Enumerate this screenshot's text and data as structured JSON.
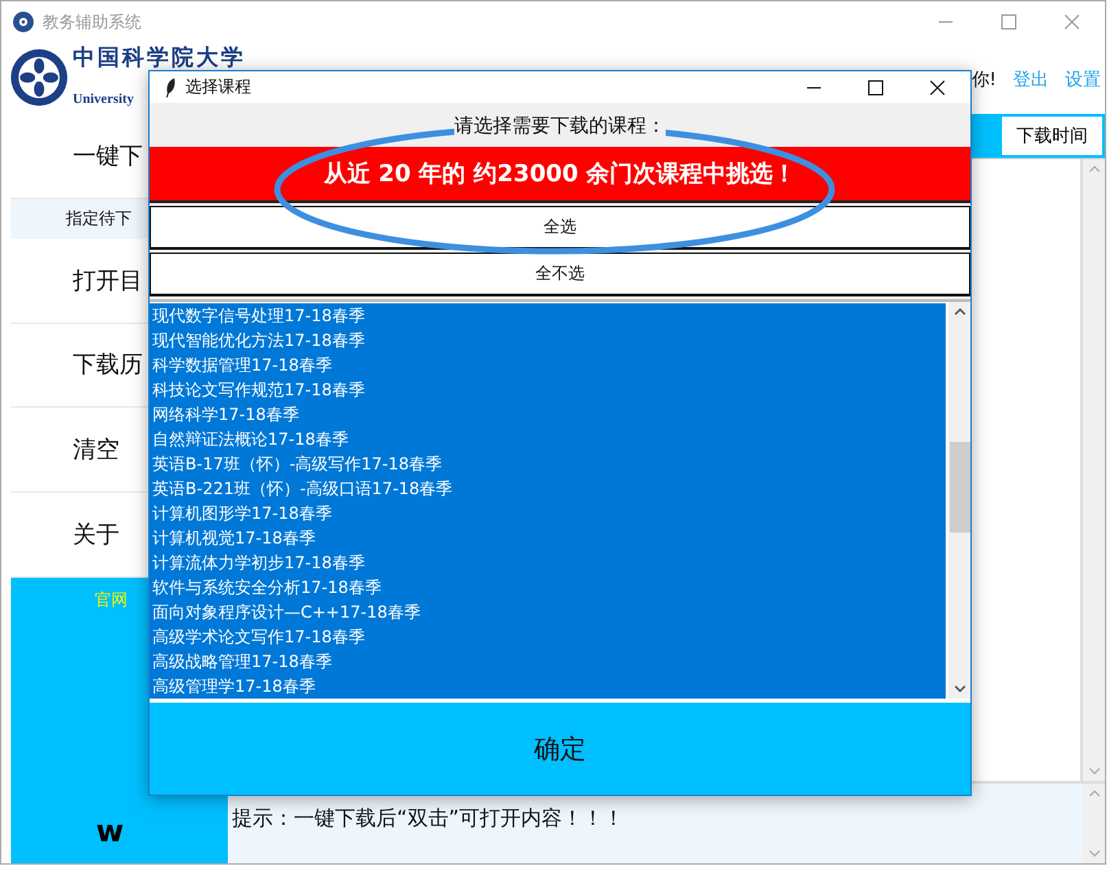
{
  "window": {
    "title": "教务辅助系统"
  },
  "header": {
    "logo_text": "中国科学院大学",
    "logo_subtitle": "University",
    "greeting": "你!",
    "links": [
      "登出",
      "设置"
    ]
  },
  "sidebar": {
    "items": [
      {
        "label": "一键下",
        "kind": "main"
      },
      {
        "label": "指定待下",
        "kind": "sub"
      },
      {
        "label": "打开目",
        "kind": "main"
      },
      {
        "label": "下载历",
        "kind": "main"
      },
      {
        "label": "清空",
        "kind": "main"
      },
      {
        "label": "关于",
        "kind": "main"
      }
    ],
    "footer_link": "官网",
    "footer_mark": "w"
  },
  "table": {
    "columns": [
      "下载时间"
    ]
  },
  "hint": "提示：一键下载后“双击”可打开内容！！！",
  "dialog": {
    "title": "选择课程",
    "prompt": "请选择需要下载的课程：",
    "banner": "从近 20 年的 约23000 余门次课程中挑选！",
    "buttons": [
      "全选",
      "全不选"
    ],
    "courses": [
      {
        "name": "现代数字信号处理17-18春季",
        "selected": true
      },
      {
        "name": "现代智能优化方法17-18春季",
        "selected": true
      },
      {
        "name": "科学数据管理17-18春季",
        "selected": true
      },
      {
        "name": "科技论文写作规范17-18春季",
        "selected": true
      },
      {
        "name": "网络科学17-18春季",
        "selected": true
      },
      {
        "name": "自然辩证法概论17-18春季",
        "selected": true
      },
      {
        "name": "英语B-17班（怀）-高级写作17-18春季",
        "selected": true
      },
      {
        "name": "英语B-221班（怀）-高级口语17-18春季",
        "selected": true
      },
      {
        "name": "计算机图形学17-18春季",
        "selected": true
      },
      {
        "name": "计算机视觉17-18春季",
        "selected": true
      },
      {
        "name": "计算流体力学初步17-18春季",
        "selected": true
      },
      {
        "name": "软件与系统安全分析17-18春季",
        "selected": true
      },
      {
        "name": "面向对象程序设计—C++17-18春季",
        "selected": true
      },
      {
        "name": "高级学术论文写作17-18春季",
        "selected": true
      },
      {
        "name": "高级战略管理17-18春季",
        "selected": true
      },
      {
        "name": "高级管理学17-18春季",
        "selected": true
      }
    ],
    "confirm": "确定"
  }
}
